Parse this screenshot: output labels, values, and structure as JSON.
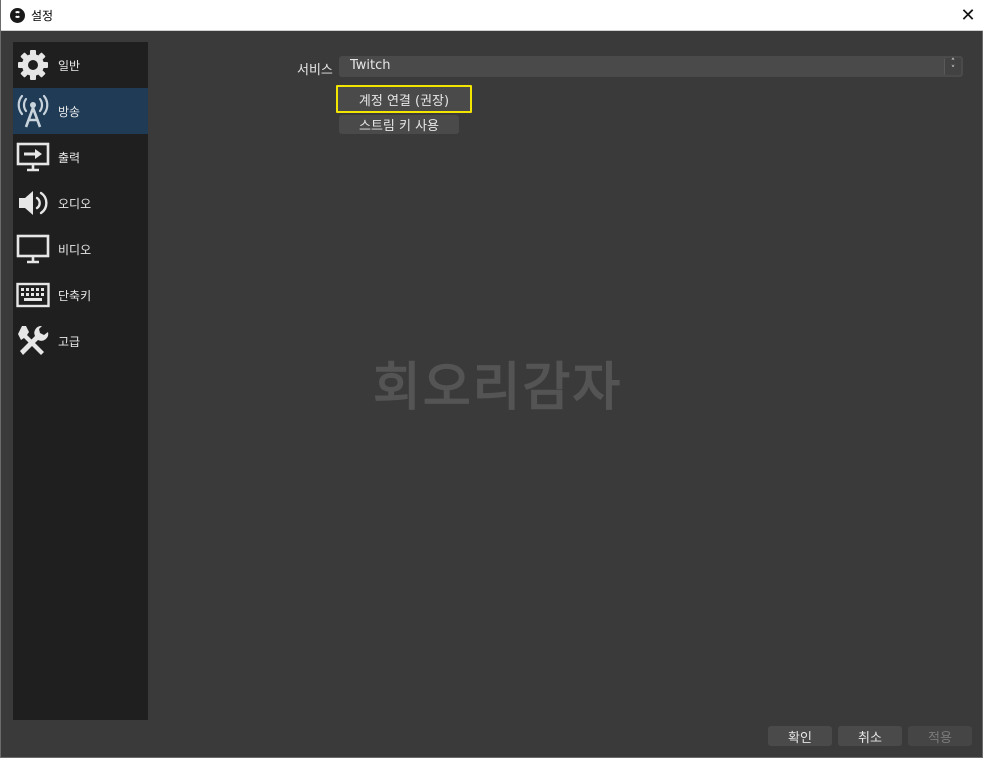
{
  "window": {
    "title": "설정",
    "close_label": "✕"
  },
  "sidebar": {
    "items": [
      {
        "label": "일반",
        "icon": "gear-icon"
      },
      {
        "label": "방송",
        "icon": "broadcast-icon",
        "active": true
      },
      {
        "label": "출력",
        "icon": "output-icon"
      },
      {
        "label": "오디오",
        "icon": "speaker-icon"
      },
      {
        "label": "비디오",
        "icon": "monitor-icon"
      },
      {
        "label": "단축키",
        "icon": "keyboard-icon"
      },
      {
        "label": "고급",
        "icon": "tools-icon"
      }
    ]
  },
  "stream": {
    "service_label": "서비스",
    "service_value": "Twitch",
    "connect_account_label": "계정 연결 (권장)",
    "use_stream_key_label": "스트림 키 사용"
  },
  "watermark": "회오리감자",
  "footer": {
    "ok_label": "확인",
    "cancel_label": "취소",
    "apply_label": "적용"
  },
  "colors": {
    "highlight": "#f2e600",
    "active_item": "#1f3b56",
    "background": "#3a3a3a",
    "sidebar": "#1f1f1f"
  }
}
